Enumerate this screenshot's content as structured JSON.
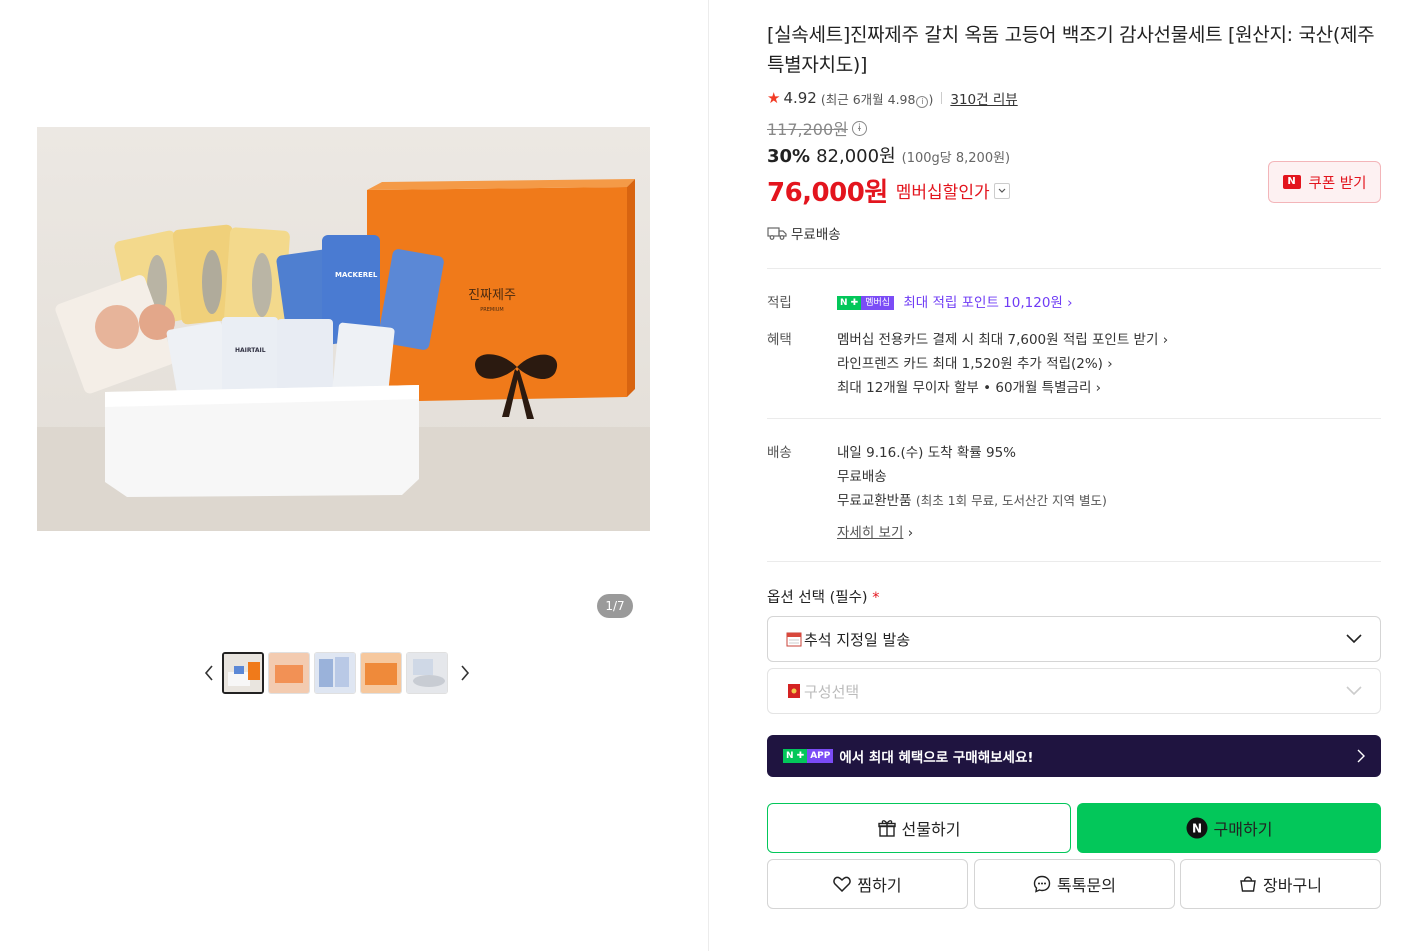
{
  "gallery": {
    "counter": "1/7",
    "box_brand": "진짜제주",
    "box_sub": "PREMIUM",
    "pack_labels": [
      "MACKEREL",
      "HAIRTAIL"
    ]
  },
  "product": {
    "title": "[실속세트]진짜제주 갈치 옥돔 고등어 백조기 감사선물세트 [원산지: 국산(제주특별자치도)]",
    "rating": "4.92",
    "rating_recent": "(최근 6개월 4.98",
    "rating_recent_close": ")",
    "reviews": "310건 리뷰",
    "original_price": "117,200원",
    "discount": "30%",
    "sale_price": "82,000원",
    "unit_price": "(100g당 8,200원)",
    "member_price": "76,000원",
    "member_label": "멤버십할인가",
    "coupon_label": "쿠폰 받기",
    "shipping_short": "무료배송"
  },
  "details": {
    "points_label": "적립",
    "points_badge": "멤버십",
    "points_text": "최대 적립 포인트 10,120원",
    "benefit_label": "혜택",
    "benefits": [
      "멤버십 전용카드 결제 시 최대 7,600원 적립 포인트 받기",
      "라인프렌즈 카드 최대 1,520원 추가 적립(2%)",
      "최대 12개월 무이자 할부 • 60개월 특별금리"
    ],
    "delivery_label": "배송",
    "delivery_lines": [
      "내일 9.16.(수) 도착 확률 95%",
      "무료배송",
      "무료교환반품"
    ],
    "return_note": "(최초 1회 무료, 도서산간 지역 별도)",
    "more_link": "자세히 보기"
  },
  "options": {
    "label": "옵션 선택 (필수)",
    "required_mark": "*",
    "select1": "추석 지정일 발송",
    "select2": "구성선택"
  },
  "banner": {
    "badge": "APP",
    "text": "에서 최대 혜택으로 구매해보세요!"
  },
  "actions": {
    "gift": "선물하기",
    "buy": "구매하기",
    "wish": "찜하기",
    "talk": "톡톡문의",
    "cart": "장바구니"
  },
  "colors": {
    "naver_green": "#03c75a",
    "sale_red": "#e3151e",
    "membership_purple": "#6f3cf5",
    "banner_bg": "#1f1440"
  }
}
